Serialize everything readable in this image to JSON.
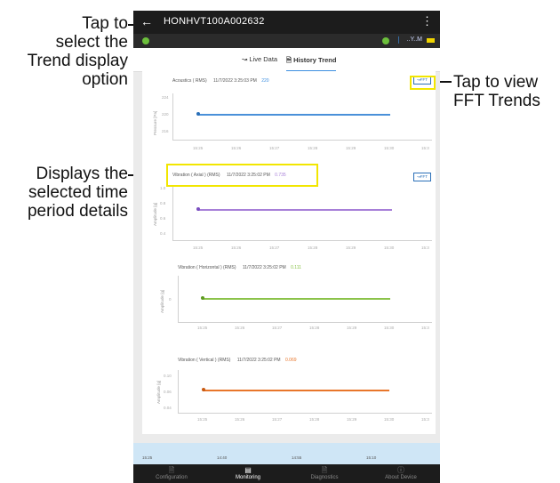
{
  "callouts": {
    "trend_option": "Tap to select the Trend display option",
    "trend_lines": [
      "Tap to",
      "select the",
      "Trend display",
      "option"
    ],
    "fft": [
      "Tap to view",
      "FFT Trends"
    ],
    "period": [
      "Displays the",
      "selected time",
      "period details"
    ]
  },
  "app": {
    "back_icon": "arrow-left-icon",
    "device_title": "HONHVT100A002632",
    "menu_icon": "kebab-menu-icon",
    "signal_text": "..Y..M"
  },
  "tabs": {
    "live": "Live Data",
    "history": "History Trend"
  },
  "charts": [
    {
      "title": "Acoustics ( RMS)",
      "timestamp": "11/7/2022 3:25:03 PM",
      "value": "220",
      "value_color": "#3d8fe0",
      "ylabel": "Pressure [Pa]",
      "yticks": [
        "224",
        "220",
        "216"
      ],
      "xticks": [
        "15:25",
        "15:26",
        "15:27",
        "15:28",
        "15:29",
        "15:30",
        "15:3"
      ],
      "color": "#4a90d9",
      "fft_label": "FFT",
      "show_fft": true
    },
    {
      "title": "Vibration ( Axial ) (RMS)",
      "timestamp": "11/7/2022 3:25:02 PM",
      "value": "0.735",
      "value_color": "#a77fd8",
      "ylabel": "Amplitude [g]",
      "yticks": [
        "1.0",
        "0.8",
        "0.6",
        "0.4"
      ],
      "xticks": [
        "15:25",
        "15:26",
        "15:27",
        "15:28",
        "15:29",
        "15:30",
        "15:3"
      ],
      "color": "#a77fd8",
      "fft_label": "FFT",
      "show_fft": true
    },
    {
      "title": "Vibration ( Horizontal ) (RMS)",
      "timestamp": "11/7/2022 3:25:02 PM",
      "value": "0.111",
      "value_color": "#8bc34a",
      "ylabel": "Amplitude [g]",
      "yticks": [
        "0"
      ],
      "xticks": [
        "15:25",
        "15:26",
        "15:27",
        "15:28",
        "15:29",
        "15:30",
        "15:3"
      ],
      "color": "#8bc34a",
      "fft_label": "",
      "show_fft": false
    },
    {
      "title": "Vibration ( Vertical ) (RMS)",
      "timestamp": "11/7/2022 3:25:02 PM",
      "value": "0.069",
      "value_color": "#e8762b",
      "ylabel": "Amplitude [g]",
      "yticks": [
        "0.10",
        "0.06",
        "0.04"
      ],
      "xticks": [
        "15:25",
        "15:26",
        "15:27",
        "15:28",
        "15:29",
        "15:30",
        "15:3"
      ],
      "color": "#e8762b",
      "fft_label": "",
      "show_fft": false
    }
  ],
  "timeline": [
    "15:25",
    "14:40",
    "14:55",
    "15:10"
  ],
  "nav": [
    {
      "label": "Configuration",
      "icon": "file-icon"
    },
    {
      "label": "Monitoring",
      "icon": "chart-icon"
    },
    {
      "label": "Diagnostics",
      "icon": "document-icon"
    },
    {
      "label": "About Device",
      "icon": "info-icon"
    }
  ],
  "colors": {
    "highlight": "#f2e600",
    "accent": "#3d8fe0",
    "topbar": "#1c1c1c"
  }
}
